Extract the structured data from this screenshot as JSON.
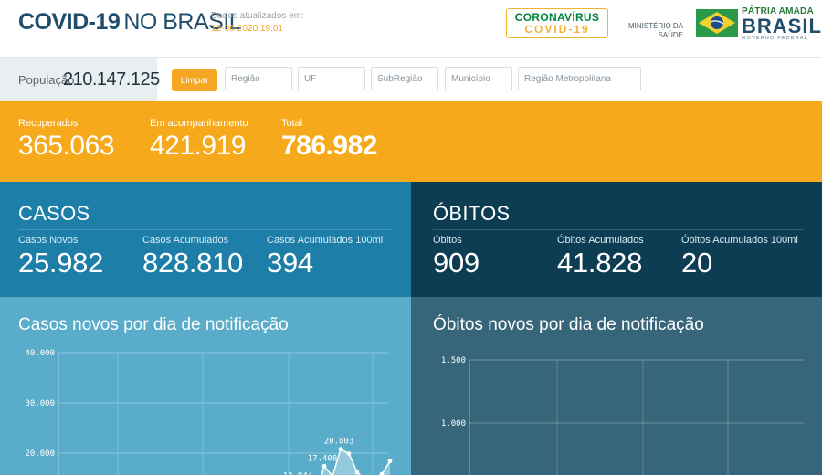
{
  "header": {
    "title_bold": "COVID-19",
    "title_rest": "NO BRASIL",
    "updated_label": "Dados atualizados em:",
    "updated_value": "12-06-2020 19:01",
    "corona_line1": "CORONAVÍRUS",
    "corona_line2": "COVID-19",
    "ministerio": "MINISTÉRIO DA SAÚDE",
    "gov_line1": "PÁTRIA AMADA",
    "gov_line2": "BRASIL",
    "gov_line3": "GOVERNO FEDERAL"
  },
  "filters": {
    "population_label": "População",
    "population_value": "210.147.125",
    "clear_label": "Limpar",
    "regiao": "Região",
    "uf": "UF",
    "subregiao": "SubRegião",
    "municipio": "Município",
    "metro": "Região Metropolitana"
  },
  "kpis": {
    "recuperados_label": "Recuperados",
    "recuperados_value": "365.063",
    "acomp_label": "Em acompanhamento",
    "acomp_value": "421.919",
    "total_label": "Total",
    "total_value": "786.982"
  },
  "casos": {
    "title": "CASOS",
    "novos_label": "Casos Novos",
    "novos_value": "25.982",
    "acum_label": "Casos Acumulados",
    "acum_value": "828.810",
    "acum100_label": "Casos Acumulados 100mi",
    "acum100_value": "394"
  },
  "obitos": {
    "title": "ÓBITOS",
    "novos_label": "Óbitos",
    "novos_value": "909",
    "acum_label": "Óbitos Acumulados",
    "acum_value": "41.828",
    "acum100_label": "Óbitos Acumulados 100mi",
    "acum100_value": "20"
  },
  "colors": {
    "orange": "#f6a91b",
    "casos_blue": "#1d7ea8",
    "obitos_navy": "#0d3d52",
    "chart_left_bg": "#5aaccb",
    "chart_right_bg": "#37667a"
  },
  "chart_data": [
    {
      "type": "area",
      "title": "Casos novos por dia de notificação",
      "ylim": [
        0,
        40000
      ],
      "yticks": [
        "40.000",
        "30.000",
        "20.000"
      ],
      "ytick_values": [
        40000,
        30000,
        20000
      ],
      "grid": true,
      "points": [
        {
          "v": 13944,
          "label": "13.944"
        },
        {
          "v": 12800,
          "label": ""
        },
        {
          "v": 12200,
          "label": ""
        },
        {
          "v": 17408,
          "label": "17.408"
        },
        {
          "v": 15400,
          "label": ""
        },
        {
          "v": 20803,
          "label": "20.803"
        },
        {
          "v": 19900,
          "label": ""
        },
        {
          "v": 16200,
          "label": ""
        },
        {
          "v": 14600,
          "label": ""
        },
        {
          "v": 13800,
          "label": ""
        },
        {
          "v": 15800,
          "label": ""
        },
        {
          "v": 18400,
          "label": ""
        }
      ]
    },
    {
      "type": "area",
      "title": "Óbitos novos por dia de notificação",
      "ylim": [
        0,
        1500
      ],
      "yticks": [
        "1.500",
        "1.000"
      ],
      "ytick_values": [
        1500,
        1000
      ],
      "grid": true,
      "points": []
    }
  ]
}
